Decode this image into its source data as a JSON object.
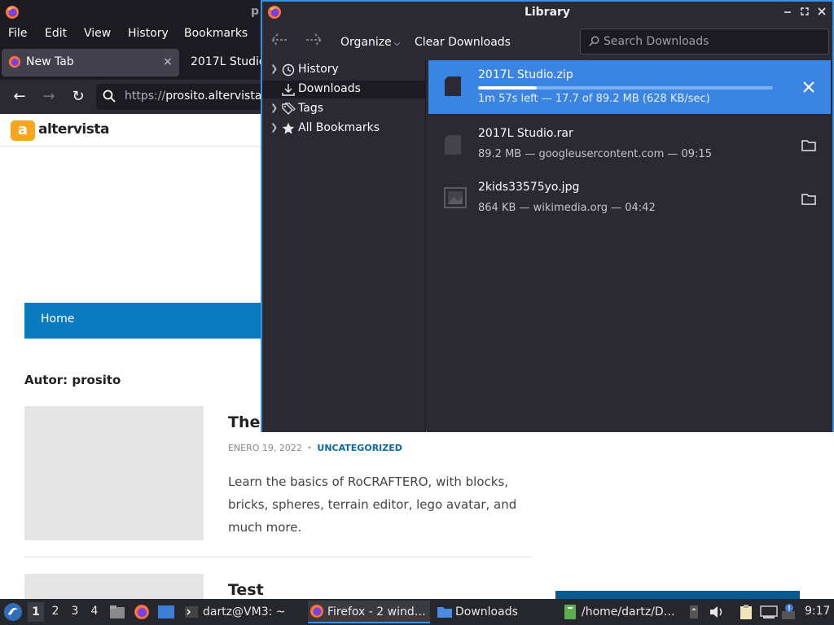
{
  "firefox": {
    "window_title": "p",
    "menu": [
      "File",
      "Edit",
      "View",
      "History",
      "Bookmarks"
    ],
    "tabs": [
      {
        "label": "New Tab",
        "close": "×"
      },
      {
        "label": "2017L Studio"
      }
    ],
    "url": {
      "base": "https://",
      "host": "prosito.altervista"
    }
  },
  "webpage": {
    "logo_letter": "a",
    "site_name": "altervista",
    "nav_home": "Home",
    "author_heading": "Autor: prosito",
    "post": {
      "title": "The",
      "date": "ENERO 19, 2022",
      "separator": "•",
      "category": "UNCATEGORIZED",
      "excerpt": "Learn the basics of RoCRAFTERO, with blocks, bricks, spheres, terrain editor, lego avatar, and much more."
    },
    "post2_title": "Test"
  },
  "library": {
    "title": "Library",
    "toolbar": {
      "organize": "Organize",
      "clear_downloads": "Clear Downloads",
      "search_placeholder": "Search Downloads"
    },
    "sidebar": [
      {
        "label": "History",
        "icon": "clock-icon",
        "expandable": true
      },
      {
        "label": "Downloads",
        "icon": "download-icon",
        "expandable": false,
        "selected": true
      },
      {
        "label": "Tags",
        "icon": "tag-icon",
        "expandable": true
      },
      {
        "label": "All Bookmarks",
        "icon": "star-icon",
        "expandable": true
      }
    ],
    "downloads": [
      {
        "name": "2017L Studio.zip",
        "status": "1m 57s left — 17.7 of 89.2 MB (628 KB/sec)",
        "progress": 0.2,
        "active": true,
        "action": "cancel"
      },
      {
        "name": "2017L Studio.rar",
        "status": "89.2 MB — googleusercontent.com — 09:15",
        "active": false,
        "action": "open-folder"
      },
      {
        "name": "2kids33575yo.jpg",
        "status": "864 KB — wikimedia.org — 04:42",
        "active": false,
        "action": "open-folder"
      }
    ],
    "colors": {
      "accent": "#3a85e3",
      "background": "#2b2a33"
    }
  },
  "taskbar": {
    "workspaces": [
      "1",
      "2",
      "3",
      "4"
    ],
    "current_workspace": "1",
    "windows": [
      {
        "label": "dartz@VM3: ~"
      },
      {
        "label": "Firefox - 2 wind…"
      },
      {
        "label": "Downloads"
      },
      {
        "label": "/home/dartz/D…"
      }
    ],
    "clock": "9:17"
  }
}
